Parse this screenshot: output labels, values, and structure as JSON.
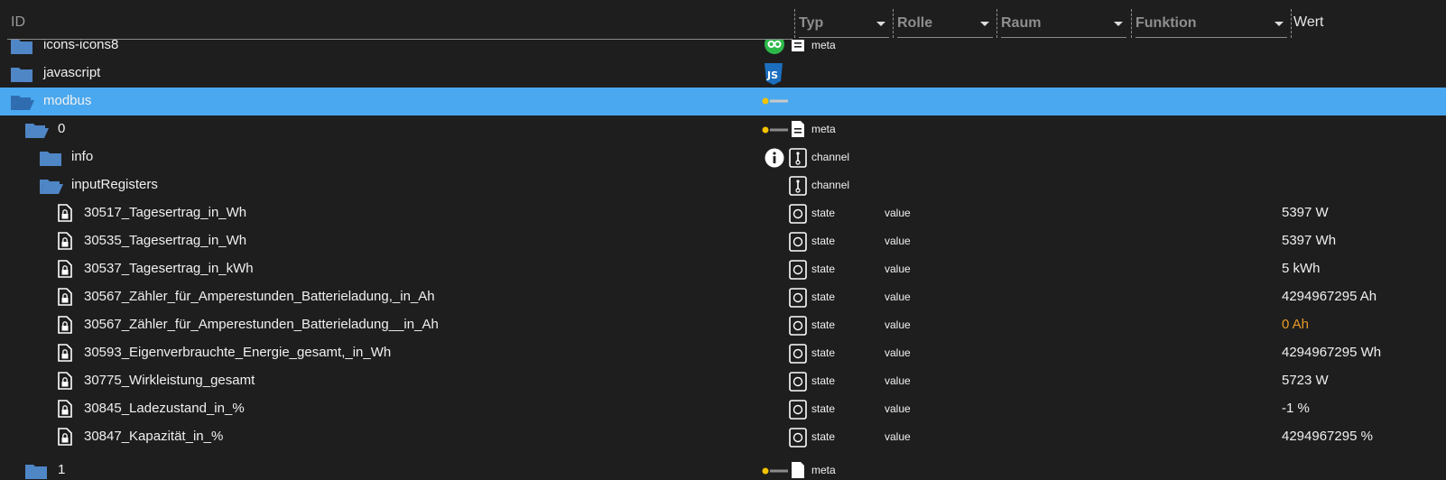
{
  "header": {
    "id_label": "ID",
    "typ_label": "Typ",
    "rolle_label": "Rolle",
    "raum_label": "Raum",
    "funktion_label": "Funktion",
    "wert_label": "Wert"
  },
  "rows": [
    {
      "name": "icons-icons8",
      "typ": "meta"
    },
    {
      "name": "javascript",
      "typ": ""
    },
    {
      "name": "modbus",
      "typ": ""
    },
    {
      "name": "0",
      "typ": "meta"
    },
    {
      "name": "info",
      "typ": "channel"
    },
    {
      "name": "inputRegisters",
      "typ": "channel"
    },
    {
      "name": "30517_Tagesertrag_in_Wh",
      "typ": "state",
      "rolle": "value",
      "wert": "5397 W"
    },
    {
      "name": "30535_Tagesertrag_in_Wh",
      "typ": "state",
      "rolle": "value",
      "wert": "5397 Wh"
    },
    {
      "name": "30537_Tagesertrag_in_kWh",
      "typ": "state",
      "rolle": "value",
      "wert": "5 kWh"
    },
    {
      "name": "30567_Zähler_für_Amperestunden_Batterieladung,_in_Ah",
      "typ": "state",
      "rolle": "value",
      "wert": "4294967295 Ah"
    },
    {
      "name": "30567_Zähler_für_Amperestunden_Batterieladung__in_Ah",
      "typ": "state",
      "rolle": "value",
      "wert": "0 Ah"
    },
    {
      "name": "30593_Eigenverbrauchte_Energie_gesamt,_in_Wh",
      "typ": "state",
      "rolle": "value",
      "wert": "4294967295 Wh"
    },
    {
      "name": "30775_Wirkleistung_gesamt",
      "typ": "state",
      "rolle": "value",
      "wert": "5723 W"
    },
    {
      "name": "30845_Ladezustand_in_%",
      "typ": "state",
      "rolle": "value",
      "wert": "-1 %"
    },
    {
      "name": "30847_Kapazität_in_%",
      "typ": "state",
      "rolle": "value",
      "wert": "4294967295 %"
    },
    {
      "name": "1",
      "typ": "meta"
    }
  ],
  "colors": {
    "background": "#1e1e1e",
    "selected": "#4aa8f0",
    "folder": "#4f86c6",
    "warn_value": "#e89a27"
  }
}
